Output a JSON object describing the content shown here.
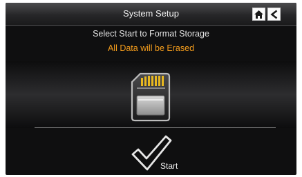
{
  "header": {
    "title": "System Setup",
    "home_icon": "home-icon",
    "back_icon": "back-arrow-icon"
  },
  "message": {
    "instruction": "Select Start to Format Storage",
    "warning": "All Data will be Erased"
  },
  "storage_icon": "sd-card-icon",
  "start_button": {
    "label": "Start",
    "icon": "checkmark-icon"
  },
  "colors": {
    "background": "#0f0f10",
    "warning_text": "#f39c1c",
    "card_contacts": "#e8b820"
  }
}
